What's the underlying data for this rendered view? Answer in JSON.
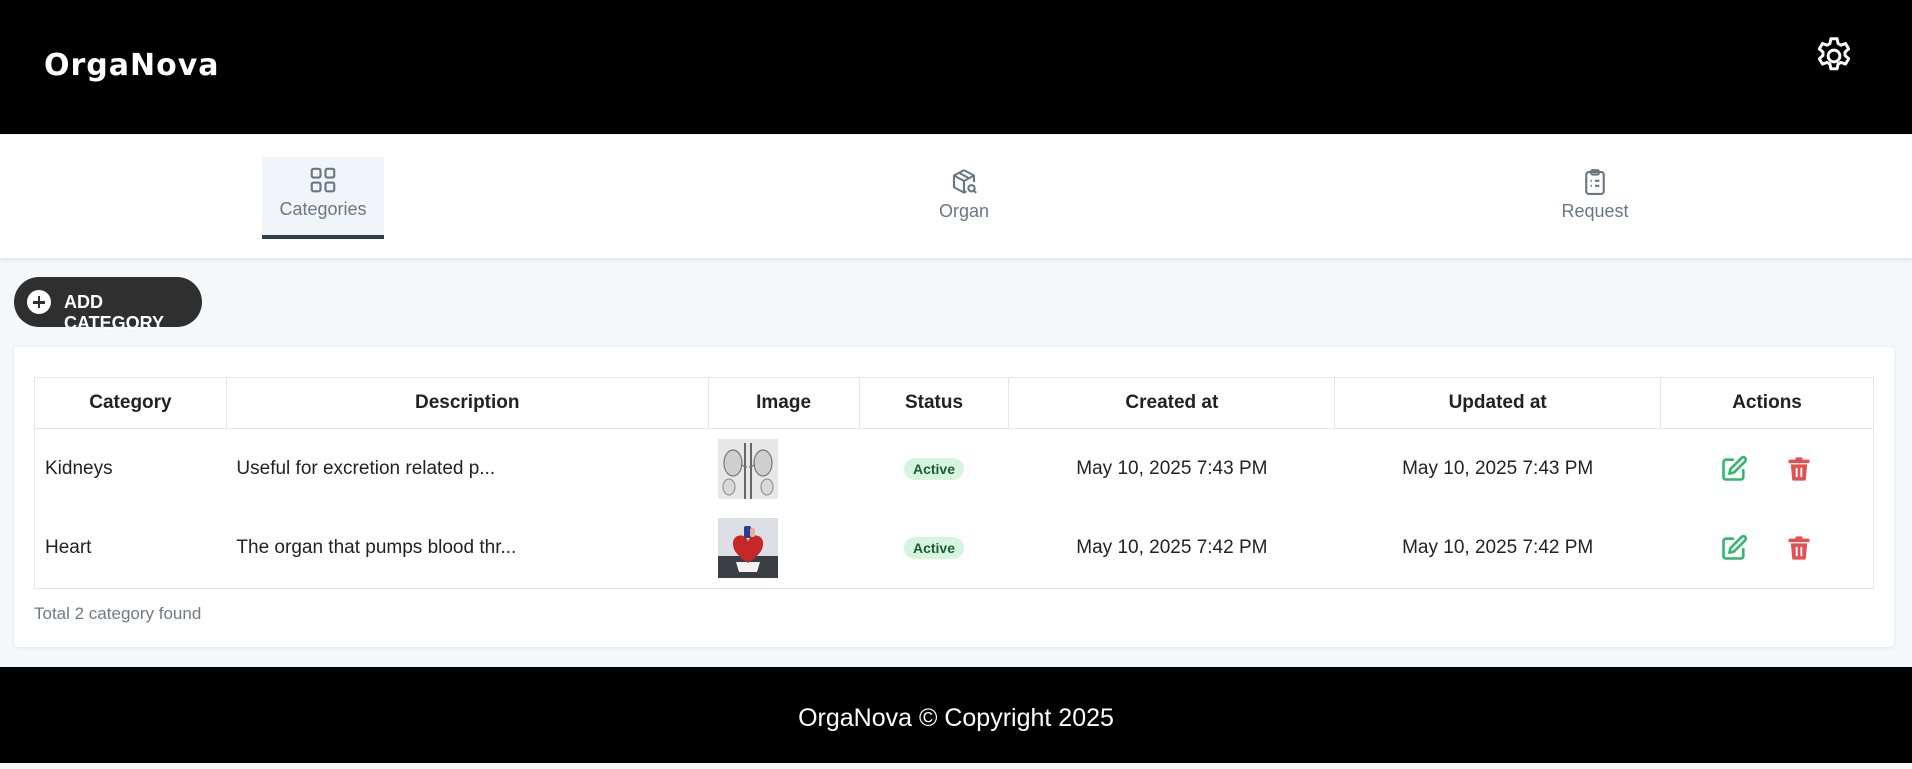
{
  "header": {
    "brand": "OrgaNova",
    "settings_icon": "gear-icon"
  },
  "tabs": [
    {
      "label": "Categories",
      "icon": "grid-icon",
      "active": true
    },
    {
      "label": "Organ",
      "icon": "package-search-icon",
      "active": false
    },
    {
      "label": "Request",
      "icon": "clipboard-list-icon",
      "active": false
    }
  ],
  "add_button": {
    "label": "ADD CATEGORY",
    "icon": "plus-circle-icon"
  },
  "table": {
    "columns": [
      "Category",
      "Description",
      "Image",
      "Status",
      "Created at",
      "Updated at",
      "Actions"
    ],
    "rows": [
      {
        "category": "Kidneys",
        "description": "Useful for excretion related p...",
        "image": "kidneys-thumbnail",
        "status": "Active",
        "created_at": "May 10, 2025 7:43 PM",
        "updated_at": "May 10, 2025 7:43 PM"
      },
      {
        "category": "Heart",
        "description": "The organ that pumps blood thr...",
        "image": "heart-thumbnail",
        "status": "Active",
        "created_at": "May 10, 2025 7:42 PM",
        "updated_at": "May 10, 2025 7:42 PM"
      }
    ]
  },
  "footer_note": "Total 2 category found",
  "footer": {
    "copyright": "OrgaNova © Copyright 2025"
  },
  "colors": {
    "header_bg": "#000000",
    "active_badge_bg": "#d5f5df",
    "edit_icon": "#2fb86b",
    "delete_icon": "#e05252",
    "active_tab_border": "#2c3e50"
  }
}
